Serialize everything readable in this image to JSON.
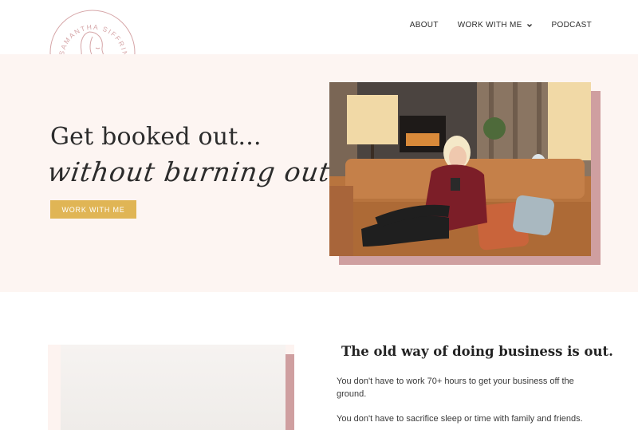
{
  "brand": {
    "name": "SAMANTHA SIFFRING",
    "logo_color": "#d6a6a8"
  },
  "nav": {
    "items": [
      {
        "label": "ABOUT"
      },
      {
        "label": "WORK WITH ME",
        "has_dropdown": true
      },
      {
        "label": "PODCAST"
      }
    ]
  },
  "hero": {
    "title": "Get booked out...",
    "script_line": "without burning out.",
    "cta_label": "WORK WITH ME",
    "cta_color": "#e0b555",
    "background": "#fdf5f2",
    "photo_accent": "#cf9fa0"
  },
  "section2": {
    "heading": "The old way of doing business is out.",
    "paragraph1": "You don't have to work 70+ hours to get your business off the ground.",
    "paragraph2": "You don't have to sacrifice sleep or time with family and friends."
  }
}
